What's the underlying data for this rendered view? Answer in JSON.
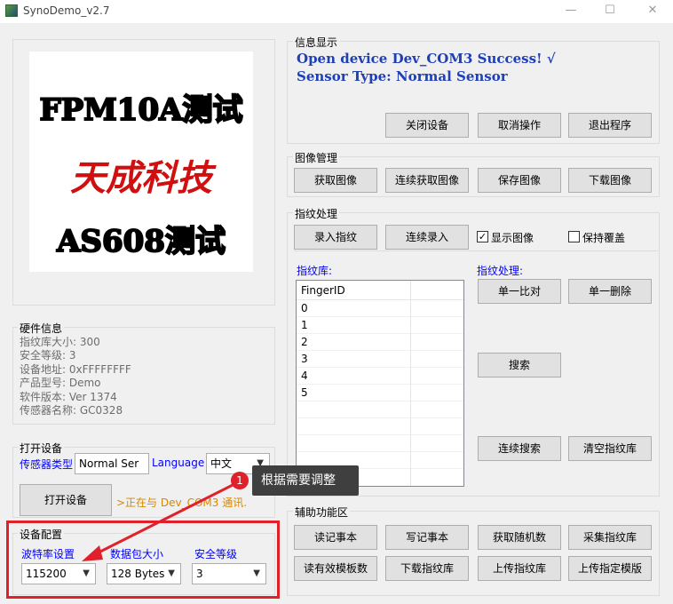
{
  "window": {
    "title": "SynoDemo_v2.7",
    "minimize": "—",
    "maximize": "☐",
    "close": "✕"
  },
  "logo": {
    "line1": "FPM10A测试",
    "line2": "天成科技",
    "line3": "AS608测试"
  },
  "hardware": {
    "title": "硬件信息",
    "lines": [
      "指纹库大小: 300",
      "安全等级: 3",
      "设备地址: 0xFFFFFFFF",
      "产品型号:  Demo",
      "软件版本: Ver 1374",
      "传感器名称: GC0328"
    ]
  },
  "open_device": {
    "title": "打开设备",
    "sensor_type_label": "传感器类型",
    "sensor_type_value": "Normal Ser",
    "language_label": "Language",
    "language_value": "中文",
    "open_button": "打开设备",
    "status_text": ">正在与 Dev_COM3 通讯."
  },
  "device_config": {
    "title": "设备配置",
    "baud_label": "波特率设置",
    "baud_value": "115200",
    "packet_label": "数据包大小",
    "packet_value": "128 Bytes",
    "security_label": "安全等级",
    "security_value": "3"
  },
  "info_display": {
    "title": "信息显示",
    "message1": "Open device Dev_COM3 Success! √",
    "message2": "Sensor Type: Normal Sensor",
    "buttons": [
      "关闭设备",
      "取消操作",
      "退出程序"
    ]
  },
  "image_mgmt": {
    "title": "图像管理",
    "buttons": [
      "获取图像",
      "连续获取图像",
      "保存图像",
      "下载图像"
    ]
  },
  "fingerprint": {
    "title": "指纹处理",
    "enroll_button": "录入指纹",
    "continuous_enroll_button": "连续录入",
    "show_image_label": "显示图像",
    "show_image_checked": true,
    "keep_overwrite_label": "保持覆盖",
    "keep_overwrite_checked": false,
    "library_label": "指纹库:",
    "list_header": "FingerID",
    "ids": [
      "0",
      "1",
      "2",
      "3",
      "4",
      "5"
    ],
    "process_label": "指纹处理:",
    "match_button": "单一比对",
    "delete_button": "单一删除",
    "search_button": "搜索",
    "continuous_search_button": "连续搜索",
    "clear_button": "清空指纹库"
  },
  "aux": {
    "title": "辅助功能区",
    "row1": [
      "读记事本",
      "写记事本",
      "获取随机数",
      "采集指纹库"
    ],
    "row2": [
      "读有效模板数",
      "下载指纹库",
      "上传指纹库",
      "上传指定模版"
    ]
  },
  "annotation": {
    "badge": "1",
    "tooltip": "根据需要调整",
    "highlight_color": "#e0202a"
  }
}
